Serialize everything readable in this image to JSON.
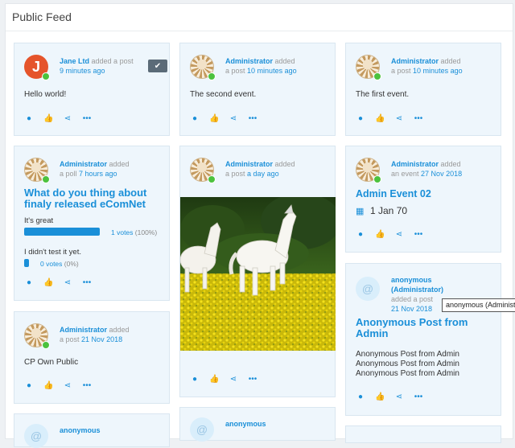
{
  "panel": {
    "title": "Public Feed"
  },
  "posts": {
    "p1": {
      "author": "Jane Ltd",
      "verb": "added a post",
      "time": "9 minutes ago",
      "avatar_letter": "J",
      "content": "Hello world!"
    },
    "p2": {
      "author": "Administrator",
      "verb1": "added",
      "verb2": "a post",
      "time": "10 minutes ago",
      "content": "The second event."
    },
    "p3": {
      "author": "Administrator",
      "verb1": "added",
      "verb2": "a post",
      "time": "10 minutes ago",
      "content": "The first event."
    },
    "poll": {
      "author": "Administrator",
      "verb1": "added",
      "verb2": "a poll",
      "time": "7 hours ago",
      "question": "What do you thing about finaly released eComNet",
      "options": [
        {
          "label": "It's great",
          "votes": "1 votes",
          "pct": "(100%)",
          "share": 1.0
        },
        {
          "label": "I didn't test it yet.",
          "votes": "0 votes",
          "pct": "(0%)",
          "share": 0.0
        }
      ]
    },
    "photo_post": {
      "author": "Administrator",
      "verb1": "added",
      "verb2": "a post",
      "time": "a day ago"
    },
    "event": {
      "author": "Administrator",
      "verb1": "added",
      "verb2": "an event",
      "time": "27 Nov 2018",
      "title": "Admin Event 02",
      "date": "1 Jan 70"
    },
    "cp": {
      "author": "Administrator",
      "verb1": "added",
      "verb2": "a post",
      "time": "21 Nov 2018",
      "content": "CP Own Public"
    },
    "anon": {
      "author": "anonymous",
      "author2": "(Administrator)",
      "verb": "added a post",
      "time": "21 Nov 2018",
      "title": "Anonymous Post from Admin",
      "lines": [
        "Anonymous Post from Admin",
        "Anonymous Post from Admin",
        "Anonymous Post from Admin"
      ]
    },
    "anon_b1": {
      "author": "anonymous"
    },
    "anon_b2": {
      "author": "anonymous"
    }
  },
  "tooltip": "anonymous (Administrator)",
  "icons": {
    "comment": "comment-icon",
    "like": "thumbs-up-icon",
    "share": "share-icon",
    "more": "more-icon",
    "check": "check-icon",
    "calendar": "calendar-icon"
  },
  "colors": {
    "accent": "#1a8fd8",
    "online": "#4cc23e",
    "card_bg": "#eef6fc"
  }
}
